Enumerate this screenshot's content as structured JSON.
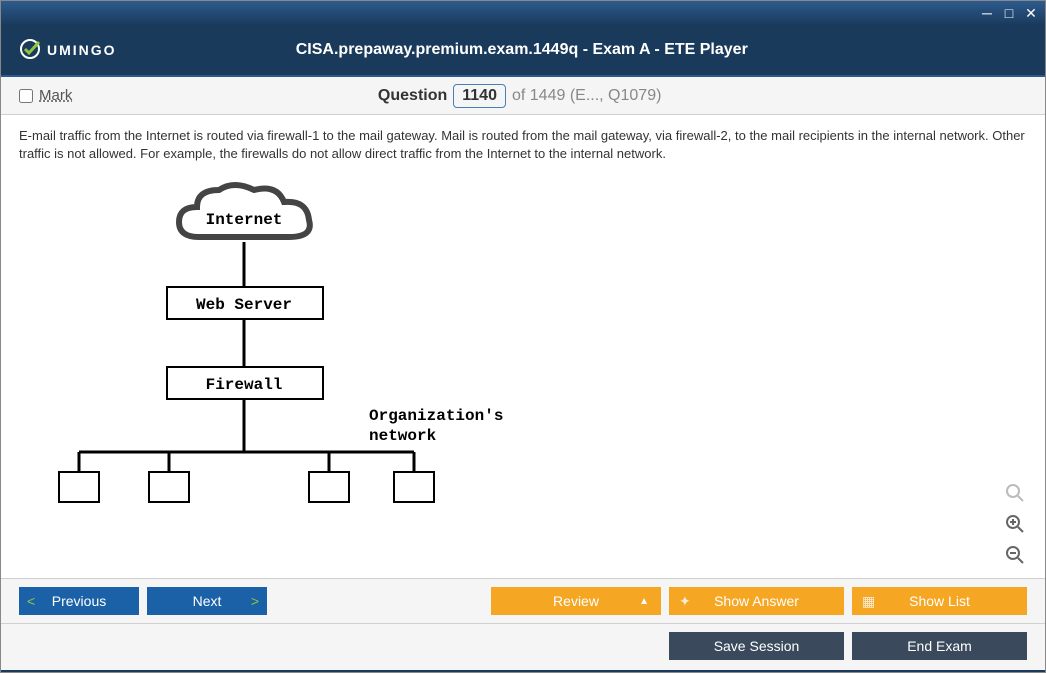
{
  "window": {
    "title": "CISA.prepaway.premium.exam.1449q - Exam A - ETE Player",
    "brand": "UMINGO"
  },
  "questionBar": {
    "mark": "Mark",
    "label": "Question",
    "number": "1140",
    "of": "of 1449",
    "suffix": "(E..., Q1079)"
  },
  "question": {
    "text": "E-mail traffic from the Internet is routed via firewall-1 to the mail gateway. Mail is routed from the mail gateway, via firewall-2, to the mail recipients in the internal network. Other traffic is not allowed. For example, the firewalls do not allow direct traffic from the Internet to the internal network."
  },
  "diagram": {
    "internet": "Internet",
    "webserver": "Web Server",
    "firewall": "Firewall",
    "network_label": "Organization's\nnetwork"
  },
  "buttons": {
    "previous": "Previous",
    "next": "Next",
    "review": "Review",
    "showAnswer": "Show Answer",
    "showList": "Show List",
    "saveSession": "Save Session",
    "endExam": "End Exam"
  }
}
